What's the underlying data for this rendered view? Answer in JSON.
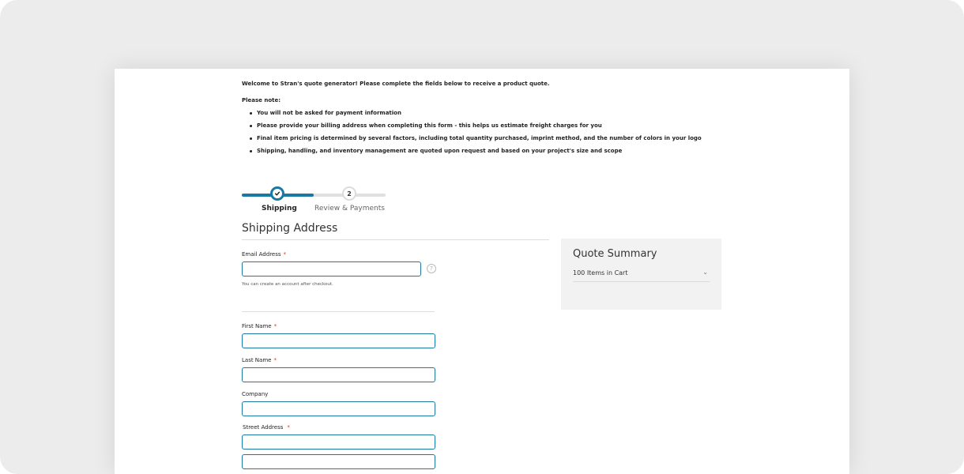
{
  "intro": {
    "welcome": "Welcome to Stran's quote generator! Please complete the fields below to receive a product quote.",
    "note_heading": "Please note:",
    "bullets": [
      "You will not be asked for payment information",
      "Please provide your billing address when completing this form - this helps us estimate freight charges for you",
      "Final item pricing is determined by several factors, including total quantity purchased, imprint method, and the number of colors in your logo",
      "Shipping, handling, and inventory management are quoted upon request and based on your project's size and scope"
    ]
  },
  "progress": {
    "step1_label": "Shipping",
    "step2_number": "2",
    "step2_label": "Review & Payments",
    "completed_fraction": 0.5
  },
  "shipping": {
    "title": "Shipping Address",
    "email_label": "Email Address",
    "email_value": "",
    "email_help": "?",
    "account_note": "You can create an account after checkout.",
    "first_name_label": "First Name",
    "first_name_value": "",
    "last_name_label": "Last Name",
    "last_name_value": "",
    "company_label": "Company",
    "company_value": "",
    "street_label": "Street Address",
    "street_line1_value": "",
    "street_line2_value": "",
    "required_mark": "*"
  },
  "summary": {
    "title": "Quote Summary",
    "items_in_cart": "100 Items in Cart",
    "expand_icon": "chevron-down-icon"
  },
  "colors": {
    "accent": "#1a79a3",
    "required": "#e02b27",
    "summary_bg": "#f2f2f2"
  }
}
